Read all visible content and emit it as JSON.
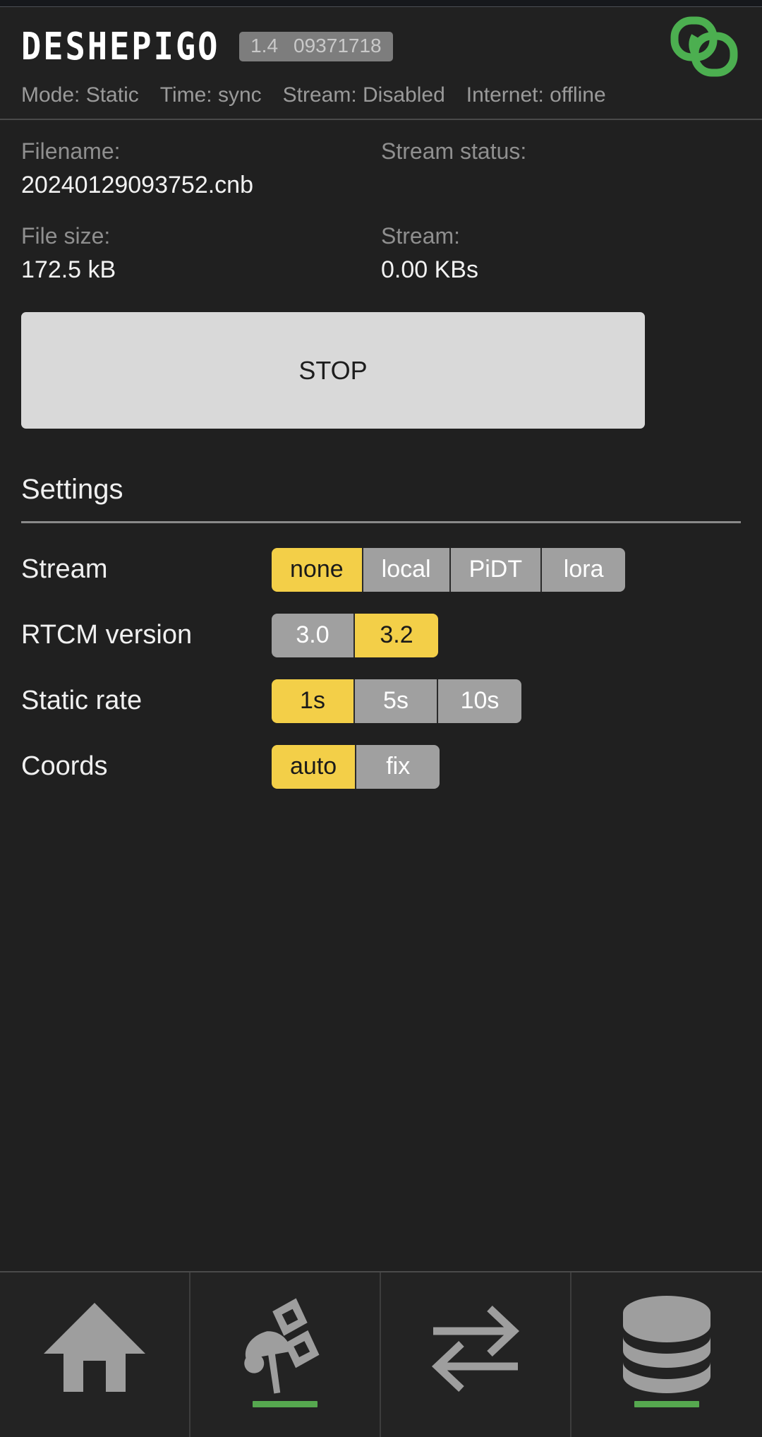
{
  "app": {
    "brand": "DESHEPIGO",
    "version": "1.4",
    "serial": "09371718",
    "logo_icon": "chain-link-icon",
    "accent_color": "#f3cf48",
    "indicator_color": "#56a84f"
  },
  "status": {
    "mode": "Mode: Static",
    "time": "Time: sync",
    "stream": "Stream: Disabled",
    "internet": "Internet: offline"
  },
  "info": {
    "filename_label": "Filename:",
    "filename_value": "20240129093752.cnb",
    "stream_status_label": "Stream status:",
    "stream_status_value": "",
    "filesize_label": "File size:",
    "filesize_value": "172.5 kB",
    "stream_label": "Stream:",
    "stream_value": "0.00 KBs"
  },
  "action": {
    "stop_label": "STOP"
  },
  "settings": {
    "title": "Settings",
    "rows": [
      {
        "name": "Stream",
        "options": [
          "none",
          "local",
          "PiDT",
          "lora"
        ],
        "selected": "none"
      },
      {
        "name": "RTCM version",
        "options": [
          "3.0",
          "3.2"
        ],
        "selected": "3.2"
      },
      {
        "name": "Static rate",
        "options": [
          "1s",
          "5s",
          "10s"
        ],
        "selected": "1s"
      },
      {
        "name": "Coords",
        "options": [
          "auto",
          "fix"
        ],
        "selected": "auto"
      }
    ]
  },
  "bottom_nav": [
    {
      "icon": "home-icon",
      "active_indicator": false
    },
    {
      "icon": "satellite-icon",
      "active_indicator": true
    },
    {
      "icon": "transfer-icon",
      "active_indicator": false
    },
    {
      "icon": "database-icon",
      "active_indicator": true
    }
  ]
}
